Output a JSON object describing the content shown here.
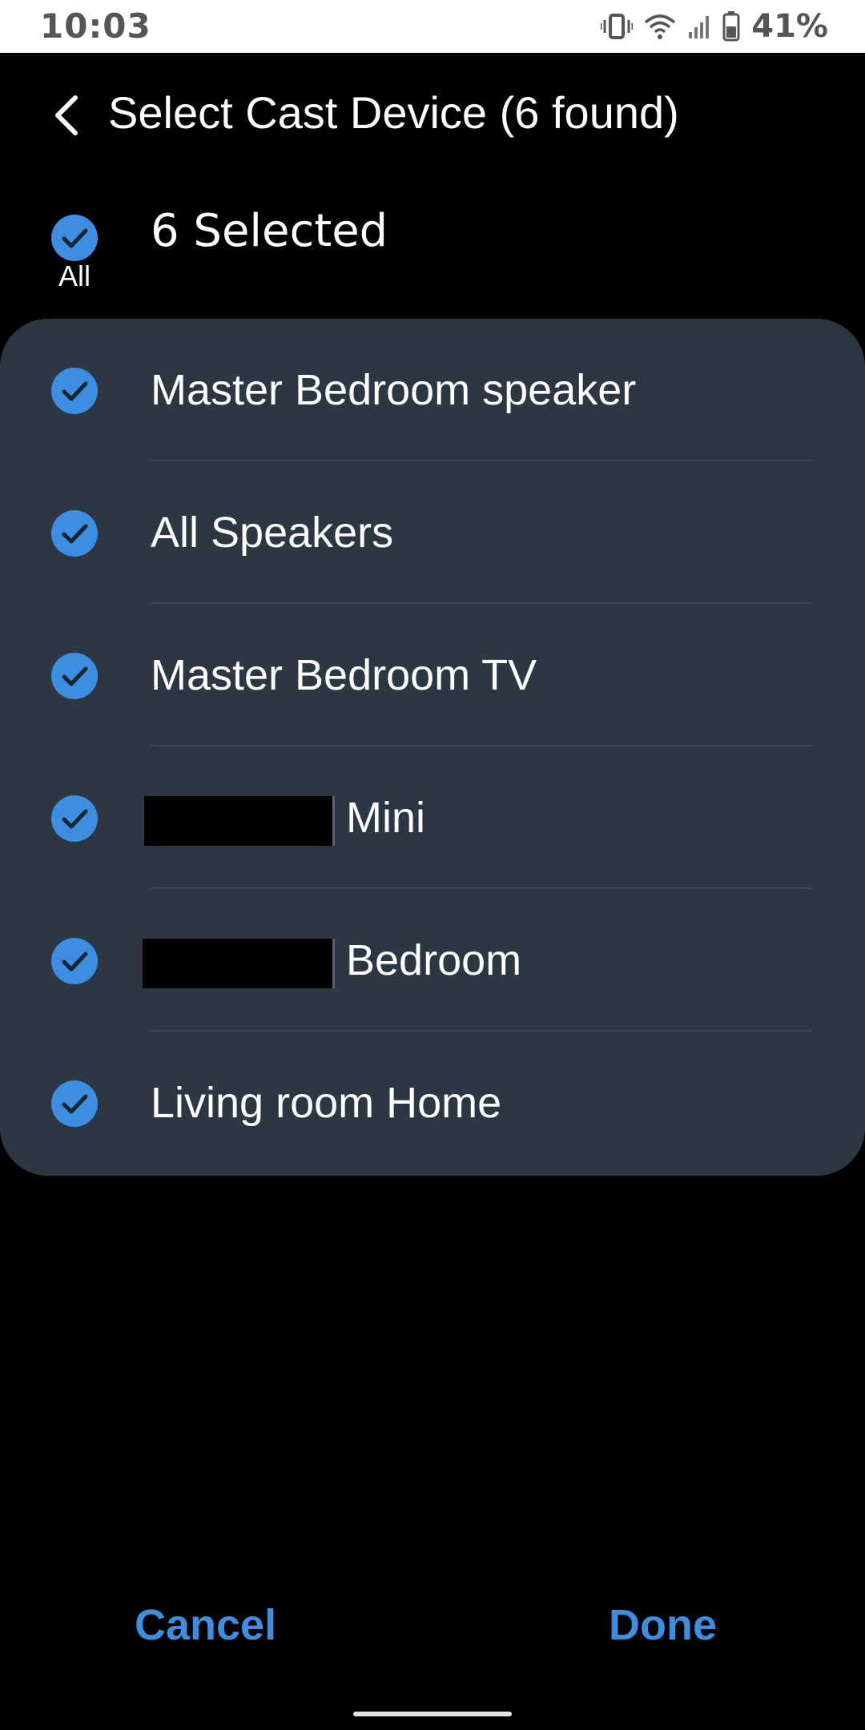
{
  "status_bar": {
    "time": "10:03",
    "battery_percent": "41%",
    "icons": [
      "vibrate-icon",
      "wifi-icon",
      "signal-icon",
      "battery-icon"
    ]
  },
  "header": {
    "title": "Select Cast Device (6 found)",
    "back_icon": "chevron-left-icon"
  },
  "select_all": {
    "label": "All",
    "count_text": "6 Selected",
    "checked": true
  },
  "devices": [
    {
      "label": "Master Bedroom speaker",
      "checked": true
    },
    {
      "label": "All Speakers",
      "checked": true
    },
    {
      "label": "Master Bedroom TV",
      "checked": true
    },
    {
      "label": "Mini",
      "checked": true,
      "redacted_prefix": true
    },
    {
      "label": "Bedroom",
      "checked": true,
      "redacted_prefix": true
    },
    {
      "label": "Living room Home",
      "checked": true
    }
  ],
  "actions": {
    "cancel_label": "Cancel",
    "done_label": "Done"
  },
  "colors": {
    "accent": "#3d8ee0",
    "check_fill": "#3d8ee0",
    "card_background": "#2c3743",
    "page_background": "#000000"
  }
}
